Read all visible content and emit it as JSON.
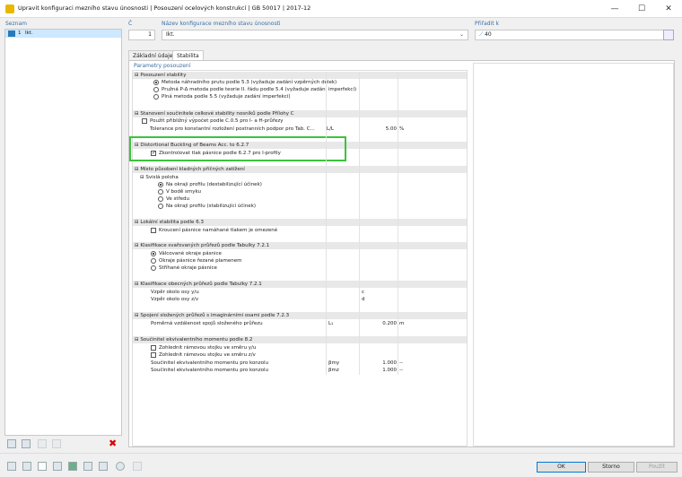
{
  "window": {
    "title": "Upravit konfiguraci mezního stavu únosnosti | Posouzení ocelových konstrukcí | GB 50017 | 2017-12",
    "minimize": "—",
    "maximize": "☐",
    "close": "✕"
  },
  "list": {
    "header": "Seznam",
    "items": [
      {
        "num": "1",
        "label": "Ikt.",
        "color": "#2a7ab8"
      }
    ]
  },
  "top_fields": {
    "number_label": "Č",
    "number_value": "1",
    "name_label": "Název konfigurace mezního stavu únosnosti",
    "name_value": "Ikt.",
    "assign_label": "Přiřadit k",
    "assign_value": "40"
  },
  "tabs": [
    "Základní údaje",
    "Stabilita"
  ],
  "params_header": "Parametry posouzení",
  "sections": {
    "stability": {
      "title": "Posouzení stability",
      "items": [
        "Metoda náhradního prutu podle 5.3 (vyžaduje zadání vzpěrných délek)",
        "Pružná P-Δ metoda podle teorie II. řádu podle 5.4 (vyžaduje zadání imperfekcí)",
        "Plná metoda podle 5.5 (vyžaduje zadání imperfekcí)"
      ]
    },
    "overall": {
      "title": "Stanovení součinitele celkové stability nosníků podle Přílohy C",
      "items": [
        "Použít přibližný výpočet podle C.0.5 pro I- a H-průřezy",
        "Tolerance pro konstantní rozložení postranních podpor pro Tab. C..."
      ],
      "tolerance_symbol": "L/L",
      "tolerance_value": "5.00",
      "tolerance_unit": "%"
    },
    "distortional": {
      "title": "Distortional Buckling of Beams Acc. to 6.2.7",
      "item": "Zkontrolovat tlak pásnice podle 6.2.7 pro I-profily"
    },
    "load_position": {
      "title": "Místo působení kladných příčných zatížení",
      "sub": "Svislá poloha",
      "items": [
        "Na okraji profilu (destabilizující účinek)",
        "V bodě smyku",
        "Ve středu",
        "Na okraji profilu (stabilizující účinek)"
      ]
    },
    "local": {
      "title": "Lokální stabilita podle 6.3",
      "item": "Kroucení pásnice namáhané tlakem je omezené"
    },
    "welded": {
      "title": "Klasifikace svařovaných průřezů podle Tabulky 7.2.1",
      "items": [
        "Válcované okraje pásnice",
        "Okraje pásnice řezané plamenem",
        "Stříhané okraje pásnice"
      ]
    },
    "general": {
      "title": "Klasifikace obecných průřezů podle Tabulky 7.2.1",
      "items": [
        {
          "label": "Vzpěr okolo osy y/u",
          "value": "c"
        },
        {
          "label": "Vzpěr okolo osy z/v",
          "value": "d"
        }
      ]
    },
    "composite": {
      "title": "Spojení složených průřezů s imaginárními osami podle 7.2.3",
      "item": "Poměrná vzdálenost spojů složeného průřezu",
      "symbol": "L₁",
      "value": "0.200",
      "unit": "m"
    },
    "moment": {
      "title": "Součinitel ekvivalentního momentu podle 8.2",
      "checks": [
        "Zohlednit rámovou stojku ve směru y/u",
        "Zohlednit rámovou stojku ve směru z/v"
      ],
      "values": [
        {
          "label": "Součinitel ekvivalentního momentu pro konzolu",
          "symbol": "βmy",
          "value": "1.000",
          "unit": "--"
        },
        {
          "label": "Součinitel ekvivalentního momentu pro konzolu",
          "symbol": "βmz",
          "value": "1.000",
          "unit": "--"
        }
      ]
    }
  },
  "buttons": {
    "ok": "OK",
    "cancel": "Storno",
    "apply": "Použít"
  },
  "highlight_color": "#3cc23c"
}
